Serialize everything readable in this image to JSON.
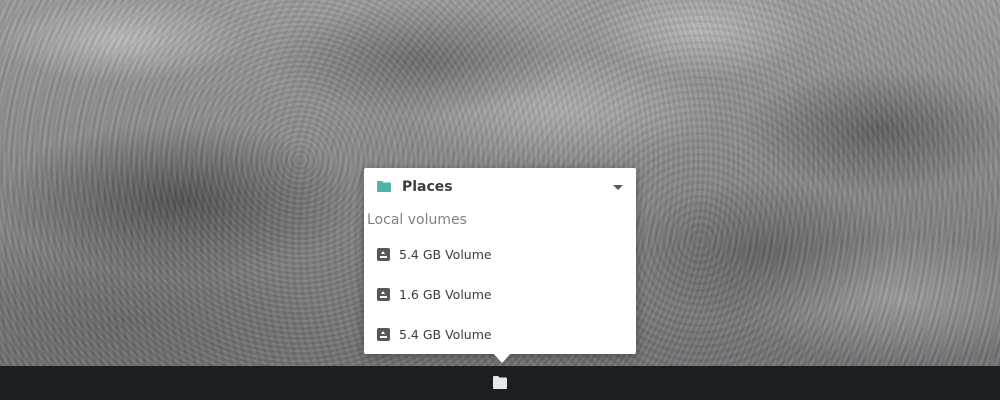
{
  "places_popup": {
    "title": "Places",
    "header_icon": "folder-icon",
    "expand_icon": "chevron-down-icon",
    "section_label": "Local volumes",
    "volumes": [
      {
        "label": "5.4 GB Volume",
        "icon": "drive-icon"
      },
      {
        "label": "1.6 GB Volume",
        "icon": "drive-icon"
      },
      {
        "label": "5.4 GB Volume",
        "icon": "drive-icon"
      }
    ]
  },
  "taskbar": {
    "applet_icon": "folder-icon"
  },
  "colors": {
    "accent": "#4fb3a9",
    "panel": "#1b1e22",
    "popup_bg": "#ffffff",
    "text_primary": "#3a3d40",
    "text_secondary": "#7d8287",
    "icon_gray": "#55595e"
  }
}
